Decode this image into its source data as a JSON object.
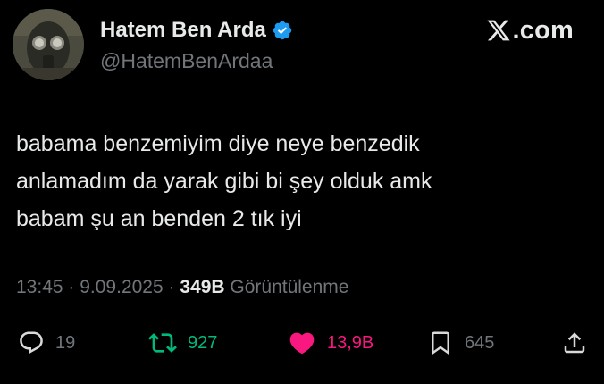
{
  "author": {
    "display_name": "Hatem Ben Arda",
    "handle": "@HatemBenArdaa",
    "verified": true,
    "avatar_icon": "gas-mask-avatar"
  },
  "brand": {
    "text": ".com",
    "logo_icon": "x-logo-icon"
  },
  "tweet": {
    "lines": [
      "babama benzemiyim diye neye benzedik",
      "anlamadım da yarak gibi bi şey olduk amk",
      "babam şu an benden 2 tık iyi"
    ]
  },
  "meta": {
    "time": "13:45",
    "separator": " · ",
    "date": "9.09.2025",
    "views_count": "349B",
    "views_label": " Görüntülenme"
  },
  "actions": {
    "replies": "19",
    "retweets": "927",
    "likes": "13,9B",
    "bookmarks": "645"
  },
  "colors": {
    "background": "#000000",
    "text_primary": "#e7e9ea",
    "text_secondary": "#71767b",
    "verified_blue": "#1d9bf0",
    "retweet_green": "#00ba7c",
    "like_pink": "#f91880"
  }
}
